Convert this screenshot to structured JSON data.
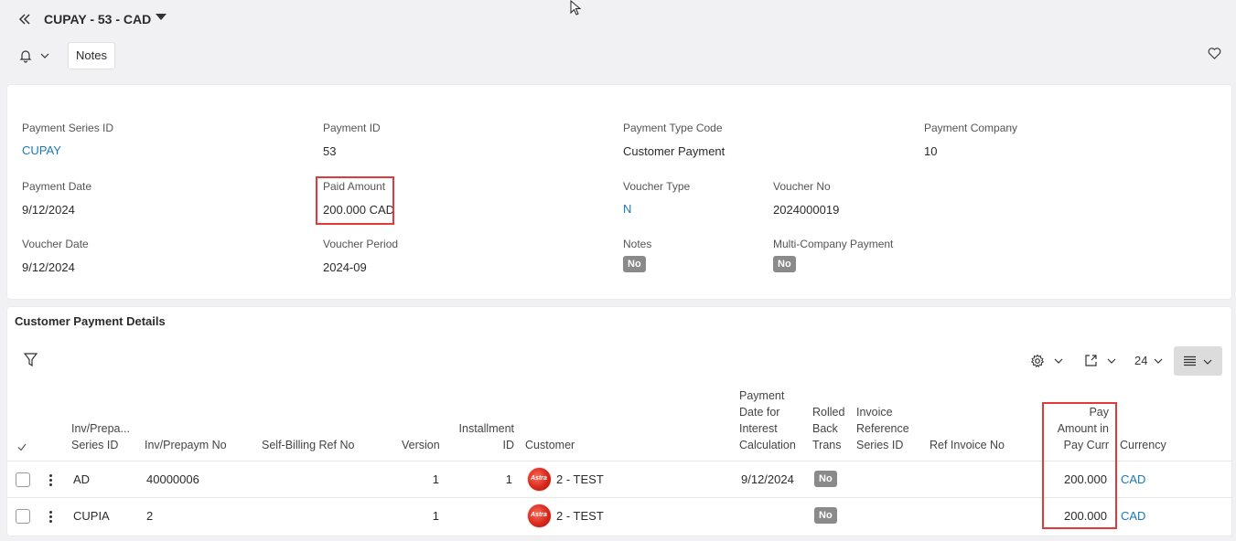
{
  "header": {
    "title": "CUPAY - 53 - CAD",
    "notes_button": "Notes"
  },
  "fields": {
    "payment_series_id": {
      "label": "Payment Series ID",
      "value": "CUPAY"
    },
    "payment_id": {
      "label": "Payment ID",
      "value": "53"
    },
    "payment_type_code": {
      "label": "Payment Type Code",
      "value": "Customer Payment"
    },
    "payment_company": {
      "label": "Payment Company",
      "value": "10"
    },
    "payment_date": {
      "label": "Payment Date",
      "value": "9/12/2024"
    },
    "paid_amount": {
      "label": "Paid Amount",
      "value": "200.000 CAD"
    },
    "voucher_type": {
      "label": "Voucher Type",
      "value": "N"
    },
    "voucher_no": {
      "label": "Voucher No",
      "value": "2024000019"
    },
    "voucher_date": {
      "label": "Voucher Date",
      "value": "9/12/2024"
    },
    "voucher_period": {
      "label": "Voucher Period",
      "value": "2024-09"
    },
    "notes": {
      "label": "Notes",
      "value": "No"
    },
    "multi_company_payment": {
      "label": "Multi-Company Payment",
      "value": "No"
    }
  },
  "details": {
    "title": "Customer Payment Details",
    "page_size": "24",
    "columns": {
      "series_id_1": "Inv/Prepa...",
      "series_id_2": "Series ID",
      "inv_no": "Inv/Prepaym No",
      "self_billing": "Self-Billing Ref No",
      "version": "Version",
      "installment_1": "Installment",
      "installment_2": "ID",
      "customer": "Customer",
      "pay_date_1": "Payment",
      "pay_date_2": "Date for",
      "pay_date_3": "Interest",
      "pay_date_4": "Calculation",
      "rolled_1": "Rolled",
      "rolled_2": "Back",
      "rolled_3": "Trans",
      "inv_ref_1": "Invoice",
      "inv_ref_2": "Reference",
      "inv_ref_3": "Series ID",
      "ref_invoice_no": "Ref Invoice No",
      "pay_amt_1": "Pay",
      "pay_amt_2": "Amount in",
      "pay_amt_3": "Pay Curr",
      "currency": "Currency"
    },
    "rows": [
      {
        "series_id": "AD",
        "inv_no": "40000006",
        "version": "1",
        "installment": "1",
        "customer": "2 - TEST",
        "pay_date": "9/12/2024",
        "rolled_back": "No",
        "pay_amount": "200.000",
        "currency": "CAD"
      },
      {
        "series_id": "CUPIA",
        "inv_no": "2",
        "version": "1",
        "installment": "",
        "customer": "2 - TEST",
        "pay_date": "",
        "rolled_back": "No",
        "pay_amount": "200.000",
        "currency": "CAD"
      }
    ]
  }
}
